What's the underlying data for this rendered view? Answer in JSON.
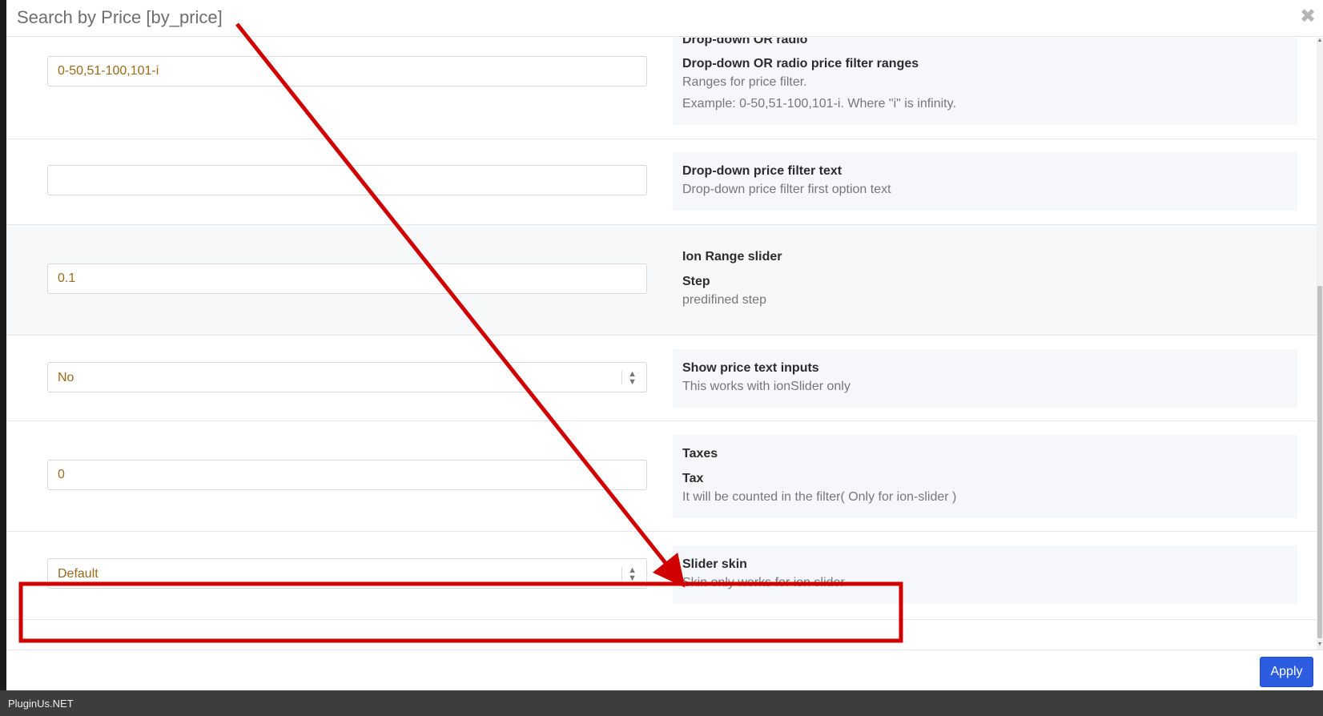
{
  "modal": {
    "title": "Search by Price [by_price]",
    "close_label": "✖"
  },
  "rows": [
    {
      "input_value": "0-50,51-100,101-i",
      "section": "Drop-down OR radio",
      "title": "Drop-down OR radio price filter ranges",
      "text1": "Ranges for price filter.",
      "text2": "Example: 0-50,51-100,101-i. Where \"i\" is infinity."
    },
    {
      "input_value": "",
      "title": "Drop-down price filter text",
      "text1": "Drop-down price filter first option text"
    },
    {
      "input_value": "0.1",
      "section": "Ion Range slider",
      "title": "Step",
      "text1": "predifined step"
    },
    {
      "select_value": "No",
      "title": "Show price text inputs",
      "text1": "This works with ionSlider only"
    },
    {
      "input_value": "0",
      "section": "Taxes",
      "title": "Tax",
      "text1": "It will be counted in the filter( Only for ion-slider )"
    },
    {
      "select_value": "Default",
      "title": "Slider skin",
      "text1": "Skin only works for ion slider"
    }
  ],
  "footer": {
    "apply_label": "Apply"
  },
  "brand": "PluginUs.NET",
  "colors": {
    "accent": "#2c5de0",
    "annotation": "#d10000"
  }
}
